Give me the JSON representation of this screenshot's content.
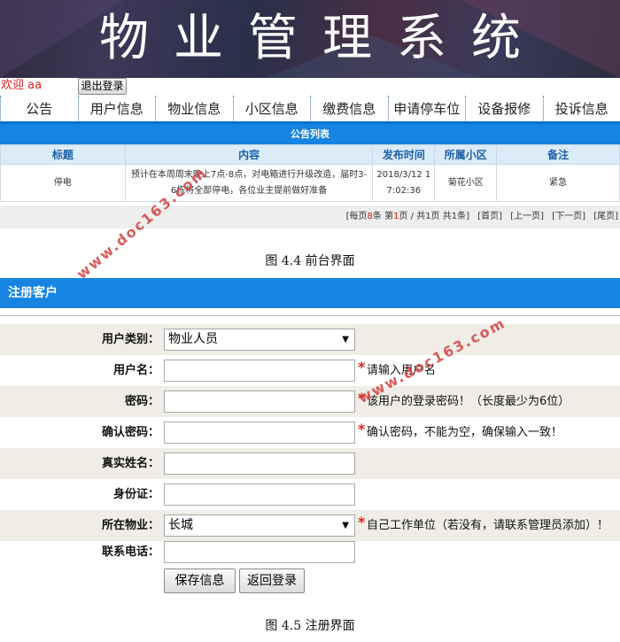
{
  "banner": {
    "title": "物业管理系统"
  },
  "user": {
    "welcome": "欢迎 aa",
    "logout_label": "退出登录"
  },
  "nav": [
    "公告",
    "用户信息",
    "物业信息",
    "小区信息",
    "缴费信息",
    "申请停车位",
    "设备报修",
    "投诉信息"
  ],
  "notice": {
    "title": "公告列表",
    "columns": [
      "标题",
      "内容",
      "发布时间",
      "所属小区",
      "备注"
    ],
    "rows": [
      {
        "title": "停电",
        "content": "预计在本周周末晚上7点-8点，对电箱进行升级改造，届时3-6栋将全部停电，各位业主提前做好准备",
        "time": "2018/3/12 17:02:36",
        "community": "菊花小区",
        "remark": "紧急"
      }
    ]
  },
  "pager": {
    "per_page_prefix": "[每页",
    "per_page": "8",
    "per_page_suffix": "条 第",
    "page": "1",
    "page_suffix": "页 / 共1页 共1条]",
    "first": "[首页]",
    "prev": "[上一页]",
    "next": "[下一页]",
    "last": "[尾页]"
  },
  "captions": {
    "fig1": "图 4.4 前台界面",
    "fig2": "图 4.5 注册界面"
  },
  "register": {
    "title": "注册客户",
    "fields": {
      "user_type": {
        "label": "用户类别：",
        "value": "物业人员"
      },
      "username": {
        "label": "用户名：",
        "value": "",
        "hint": "请输入用户名"
      },
      "password": {
        "label": "密码：",
        "value": "",
        "hint": "该用户的登录密码！（长度最少为6位）"
      },
      "confirm": {
        "label": "确认密码：",
        "value": "",
        "hint": "确认密码，不能为空，确保输入一致！"
      },
      "realname": {
        "label": "真实姓名：",
        "value": ""
      },
      "idcard": {
        "label": "身份证：",
        "value": ""
      },
      "property": {
        "label": "所在物业：",
        "value": "长城",
        "hint": "自己工作单位（若没有，请联系管理员添加）！"
      },
      "phone": {
        "label": "联系电话：",
        "value": ""
      }
    },
    "save_label": "保存信息",
    "back_label": "返回登录"
  },
  "watermark": "www.doc163.com",
  "colors": {
    "accent": "#1684e0",
    "required": "#e02020",
    "welcome": "#e02020"
  }
}
